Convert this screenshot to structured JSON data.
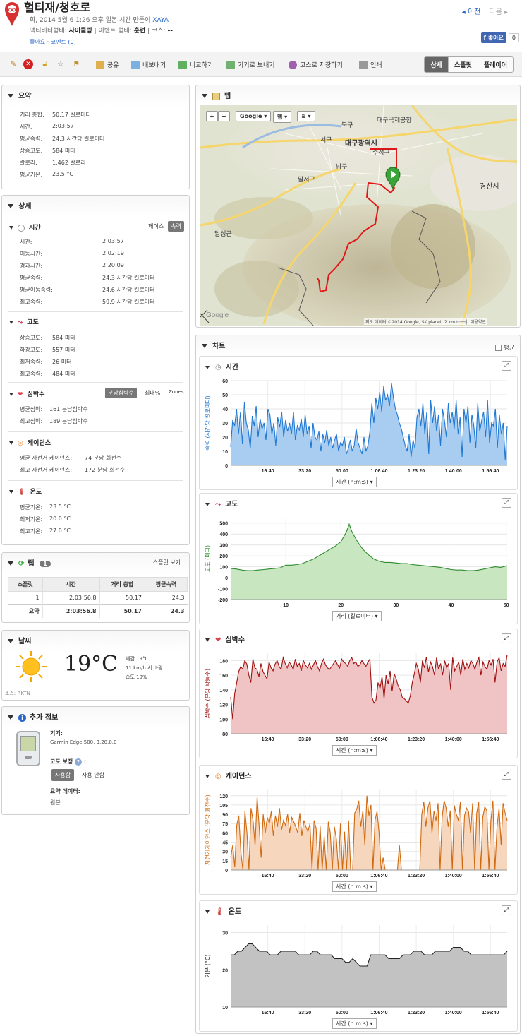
{
  "header": {
    "title": "헐티재/청호로",
    "meta_line1": "화, 2014 5월 6 1:26 오후 일본 시간 만든이",
    "author": "XAYA",
    "activity_type_label": "액티비티형태:",
    "activity_type": "사이클링",
    "event_type_label": "| 이벤트 형태:",
    "event_type": "훈련",
    "course_label": "| 코스:",
    "course": "--",
    "like_link": "좋아요",
    "comment_link": "코멘트 (0)",
    "prev": "◂ 이전",
    "next": "다음 ▸",
    "fb_like": "f 좋아요",
    "fb_count": "0"
  },
  "toolbar": {
    "share": "공유",
    "export": "내보내기",
    "compare": "비교하기",
    "send_device": "기기로 보내기",
    "save_course": "코스로 저장하기",
    "print": "인쇄",
    "views": [
      "상세",
      "스플릿",
      "플레이어"
    ]
  },
  "summary": {
    "title": "요약",
    "rows": [
      {
        "k": "거리 총합:",
        "v": "50.17 킬로미터"
      },
      {
        "k": "시간:",
        "v": "2:03:57"
      },
      {
        "k": "평균속력:",
        "v": "24.3 시간당 킬로미터"
      },
      {
        "k": "상승고도:",
        "v": "584 미터"
      },
      {
        "k": "칼로리:",
        "v": "1,462 칼로리"
      },
      {
        "k": "평균기온:",
        "v": "23.5 °C"
      }
    ]
  },
  "details": {
    "title": "상세",
    "time": {
      "title": "시간",
      "pace": "페이스",
      "speed": "속력",
      "rows": [
        {
          "k": "시간:",
          "v": "2:03:57"
        },
        {
          "k": "이동시간:",
          "v": "2:02:19"
        },
        {
          "k": "경과시간:",
          "v": "2:20:09"
        },
        {
          "k": "평균속력:",
          "v": "24.3 시간당 킬로미터"
        },
        {
          "k": "평균이동속력:",
          "v": "24.6 시간당 킬로미터"
        },
        {
          "k": "최고속력:",
          "v": "59.9 시간당 킬로미터"
        }
      ]
    },
    "elevation": {
      "title": "고도",
      "rows": [
        {
          "k": "상승고도:",
          "v": "584 미터"
        },
        {
          "k": "하강고도:",
          "v": "557 미터"
        },
        {
          "k": "최저속력:",
          "v": "26 미터"
        },
        {
          "k": "최고속력:",
          "v": "484 미터"
        }
      ]
    },
    "hr": {
      "title": "심박수",
      "bpm": "분당심박수",
      "max": "최대%",
      "zones": "Zones",
      "rows": [
        {
          "k": "평균심박:",
          "v": "161 분당심박수"
        },
        {
          "k": "최고심박:",
          "v": "189 분당심박수"
        }
      ]
    },
    "cadence": {
      "title": "케이던스",
      "rows": [
        {
          "k": "평균 자전거 케이던스:",
          "v": "74 분당 회전수"
        },
        {
          "k": "최고 자전거 케이던스:",
          "v": "172 분당 회전수"
        }
      ]
    },
    "temp": {
      "title": "온도",
      "rows": [
        {
          "k": "평균기온:",
          "v": "23.5 °C"
        },
        {
          "k": "최저기온:",
          "v": "20.0 °C"
        },
        {
          "k": "최고기온:",
          "v": "27.0 °C"
        }
      ]
    }
  },
  "laps": {
    "title": "랩",
    "count": "1",
    "splits_link": "스플릿 보기",
    "headers": [
      "스플릿",
      "시간",
      "거리 총합",
      "평균속력"
    ],
    "row": [
      "1",
      "2:03:56.8",
      "50.17",
      "24.3"
    ],
    "summary": [
      "요약",
      "2:03:56.8",
      "50.17",
      "24.3"
    ]
  },
  "weather": {
    "title": "날씨",
    "temp": "19°C",
    "feels": "체감 19°C",
    "wind": "11 km/h 서 바람",
    "humidity": "습도 19%",
    "source": "소스: RKTN"
  },
  "info": {
    "title": "추가 정보",
    "device_label": "기기:",
    "device": "Garmin Edge 500, 3.20.0.0",
    "elev_corr_label": "고도 보정",
    "use": "사용함",
    "not_use": "사용 안함",
    "summary_data_label": "요약 데이터:",
    "summary_data": "원본"
  },
  "map": {
    "title": "맵",
    "provider": "Google",
    "map_btn": "맵",
    "attribution": "지도 데이터 ©2014 Google, SK planet",
    "scale": "2 km",
    "terms": "이용약관",
    "labels": {
      "city": "대구광역시",
      "airport": "대구국제공항",
      "buk": "북구",
      "seo": "서구",
      "nam": "남구",
      "suseong": "수성구",
      "dalseo": "달서구",
      "gyeongsan": "경산시",
      "dalseong": "달성군",
      "google": "Google"
    }
  },
  "charts_panel": {
    "title": "차트",
    "avg": "평균"
  },
  "colors": {
    "speed": "#1f78d1",
    "elev": "#2e8b2e",
    "hr": "#a01010",
    "cad": "#d06a10",
    "temp": "#222222"
  },
  "chart_data": [
    {
      "type": "area",
      "title": "시간",
      "ylabel": "속력 (시간당 킬로미터)",
      "xlabel": "시간 (h:m:s)",
      "xticks": [
        "16:40",
        "33:20",
        "50:00",
        "1:06:40",
        "1:23:20",
        "1:40:00",
        "1:56:40"
      ],
      "yticks": [
        "0",
        "10",
        "20",
        "30",
        "40",
        "50",
        "60"
      ],
      "ylim": [
        0,
        60
      ],
      "values": [
        13,
        32,
        28,
        40,
        22,
        38,
        15,
        45,
        30,
        25,
        12,
        35,
        28,
        42,
        20,
        33,
        26,
        30,
        18,
        40,
        36,
        22,
        30,
        14,
        34,
        27,
        38,
        20,
        32,
        24,
        30,
        22,
        38,
        18,
        28,
        25,
        33,
        20,
        36,
        22,
        28,
        12,
        30,
        20,
        18,
        24,
        10,
        22,
        16,
        25,
        14,
        20,
        12,
        18,
        22,
        10,
        16,
        14,
        20,
        8,
        12,
        18,
        10,
        14,
        26,
        16,
        12,
        8,
        20,
        10,
        14,
        24,
        44,
        30,
        48,
        40,
        52,
        38,
        56,
        46,
        50,
        42,
        58,
        48,
        40,
        36,
        30,
        26,
        20,
        14,
        10,
        22,
        6,
        18,
        12,
        34,
        40,
        28,
        44,
        22,
        38,
        8,
        46,
        30,
        42,
        24,
        36,
        14,
        40,
        32,
        20,
        44,
        30,
        38,
        26,
        46,
        22,
        34,
        6,
        40,
        30,
        42,
        16,
        36,
        28,
        12,
        44,
        24,
        32,
        38,
        20,
        46,
        16,
        30,
        28,
        40,
        12,
        36,
        22,
        30,
        4,
        28
      ]
    },
    {
      "type": "area",
      "title": "고도",
      "ylabel": "고도 (미터)",
      "xlabel": "거리 (킬로미터)",
      "xticks": [
        "10",
        "20",
        "30",
        "40",
        "50"
      ],
      "yticks": [
        "-200",
        "-100",
        "0",
        "100",
        "200",
        "300",
        "400",
        "500"
      ],
      "ylim": [
        -200,
        550
      ],
      "xlim": [
        0,
        50.17
      ],
      "x": [
        0,
        1,
        2,
        3,
        4,
        5,
        6,
        7,
        8,
        9,
        10,
        11,
        12,
        13,
        14,
        15,
        16,
        17,
        18,
        19,
        20,
        21,
        21.5,
        22,
        23,
        24,
        25,
        26,
        27,
        28,
        29,
        30,
        31,
        32,
        33,
        34,
        35,
        36,
        37,
        38,
        39,
        40,
        41,
        42,
        43,
        44,
        45,
        46,
        47,
        48,
        49,
        50.17
      ],
      "values": [
        85,
        80,
        70,
        65,
        65,
        70,
        75,
        80,
        85,
        90,
        115,
        115,
        120,
        130,
        150,
        170,
        200,
        230,
        260,
        290,
        330,
        420,
        490,
        420,
        330,
        260,
        210,
        170,
        150,
        140,
        140,
        135,
        130,
        130,
        120,
        115,
        110,
        105,
        100,
        95,
        85,
        75,
        70,
        70,
        65,
        65,
        70,
        80,
        90,
        100,
        95,
        110
      ]
    },
    {
      "type": "area",
      "title": "심박수",
      "ylabel": "심박수 (분당 박동수)",
      "xlabel": "시간 (h:m:s)",
      "xticks": [
        "16:40",
        "33:20",
        "50:00",
        "1:06:40",
        "1:23:20",
        "1:40:00",
        "1:56:40"
      ],
      "yticks": [
        "80",
        "100",
        "120",
        "140",
        "160",
        "180"
      ],
      "ylim": [
        80,
        190
      ],
      "values": [
        130,
        100,
        135,
        150,
        165,
        172,
        168,
        180,
        175,
        160,
        150,
        182,
        170,
        168,
        158,
        176,
        165,
        160,
        155,
        178,
        170,
        166,
        175,
        180,
        172,
        168,
        184,
        176,
        170,
        178,
        174,
        168,
        182,
        172,
        176,
        166,
        180,
        174,
        170,
        176,
        168,
        174,
        180,
        172,
        166,
        176,
        182,
        174,
        170,
        168,
        172,
        176,
        180,
        174,
        170,
        182,
        178,
        176,
        172,
        180,
        184,
        176,
        178,
        172,
        174,
        180,
        176,
        172,
        178,
        182,
        130,
        122,
        126,
        150,
        142,
        158,
        128,
        160,
        148,
        166,
        138,
        162,
        155,
        145,
        140,
        130,
        128,
        125,
        122,
        132,
        150,
        162,
        176,
        168,
        150,
        180,
        170,
        185,
        164,
        178,
        172,
        160,
        184,
        168,
        176,
        160,
        180,
        170,
        176,
        140,
        184,
        166,
        172,
        178,
        160,
        182,
        168,
        176,
        170,
        180,
        176,
        168,
        178,
        184,
        160,
        178,
        172,
        168,
        180,
        174,
        182,
        150,
        178,
        184,
        166,
        176,
        172,
        188
      ]
    },
    {
      "type": "area",
      "title": "케이던스",
      "ylabel": "자전거케이던스 (분당 회전수)",
      "xlabel": "시간 (h:m:s)",
      "xticks": [
        "16:40",
        "33:20",
        "50:00",
        "1:06:40",
        "1:23:20",
        "1:40:00",
        "1:56:40"
      ],
      "yticks": [
        "0",
        "15",
        "30",
        "45",
        "60",
        "75",
        "90",
        "105",
        "120"
      ],
      "ylim": [
        0,
        130
      ],
      "values": [
        20,
        40,
        5,
        72,
        88,
        30,
        0,
        95,
        60,
        0,
        100,
        80,
        40,
        118,
        70,
        20,
        90,
        60,
        85,
        75,
        95,
        55,
        88,
        70,
        100,
        65,
        80,
        72,
        90,
        60,
        85,
        78,
        70,
        60,
        92,
        55,
        80,
        70,
        62,
        75,
        0,
        80,
        68,
        0,
        72,
        0,
        55,
        0,
        78,
        60,
        0,
        70,
        50,
        0,
        75,
        0,
        62,
        0,
        80,
        0,
        0,
        92,
        98,
        112,
        70,
        96,
        40,
        120,
        88,
        105,
        0,
        80,
        95,
        60,
        0,
        20,
        0,
        0,
        0,
        0,
        0,
        0,
        0,
        40,
        0,
        0,
        0,
        0,
        0,
        0,
        0,
        0,
        0,
        0,
        90,
        110,
        70,
        100,
        112,
        60,
        95,
        80,
        108,
        0,
        85,
        112,
        100,
        70,
        96,
        0,
        104,
        90,
        80,
        110,
        0,
        88,
        100,
        95,
        60,
        108,
        0,
        92,
        110,
        0,
        85,
        102,
        96,
        0,
        80,
        112,
        0,
        70,
        100,
        40,
        108,
        92,
        80
      ]
    },
    {
      "type": "area",
      "title": "온도",
      "ylabel": "기온 (°C)",
      "xlabel": "시간 (h:m:s)",
      "xticks": [
        "16:40",
        "33:20",
        "50:00",
        "1:06:40",
        "1:23:20",
        "1:40:00",
        "1:56:40"
      ],
      "yticks": [
        "10",
        "20",
        "30"
      ],
      "ylim": [
        10,
        32
      ],
      "values": [
        24,
        24,
        25,
        25,
        26,
        27,
        27,
        26,
        25,
        25,
        25,
        24,
        24,
        24,
        25,
        25,
        25,
        25,
        25,
        24,
        24,
        24,
        24,
        25,
        25,
        24,
        24,
        24,
        24,
        23,
        23,
        23,
        22,
        22,
        23,
        22,
        21,
        21,
        21,
        24,
        24,
        24,
        24,
        24,
        23,
        23,
        23,
        23,
        24,
        24,
        24,
        25,
        25,
        25,
        24,
        24,
        24,
        25,
        25,
        25,
        25,
        25,
        26,
        26,
        26,
        25,
        25,
        24,
        24,
        24,
        24,
        24,
        24,
        24,
        24,
        24,
        24,
        25
      ]
    }
  ]
}
